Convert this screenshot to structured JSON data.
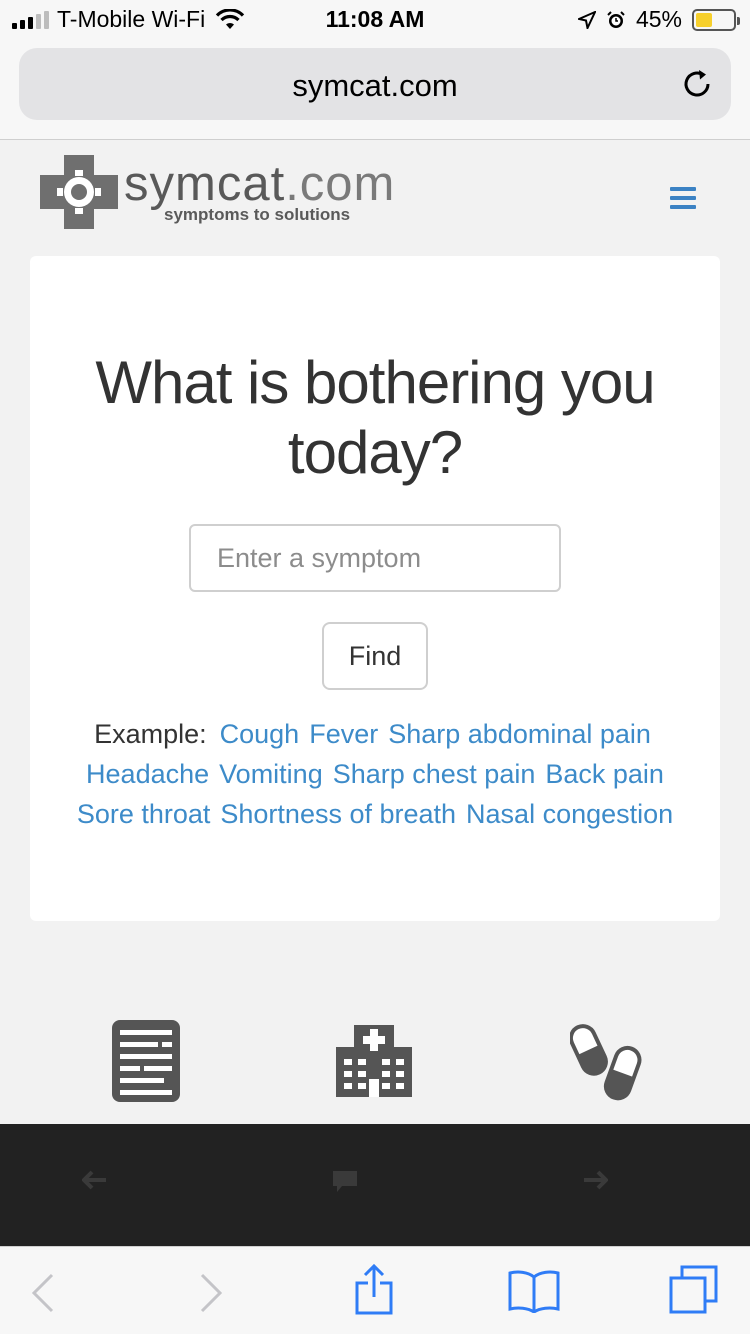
{
  "status_bar": {
    "carrier": "T-Mobile Wi-Fi",
    "time": "11:08 AM",
    "battery": "45%",
    "battery_level": 0.45,
    "icons": [
      "signal-icon",
      "wifi-icon",
      "location-icon",
      "alarm-icon",
      "battery-icon"
    ]
  },
  "address_bar": {
    "url": "symcat.com",
    "reload_icon": "reload-icon"
  },
  "site": {
    "logo_name": "symcat",
    "logo_domain": ".com",
    "logo_tagline": "symptoms to solutions",
    "menu_icon": "hamburger-menu-icon",
    "accent_color": "#3d8bc9"
  },
  "search": {
    "headline_line1": "What is bothering you",
    "headline_line2": "today?",
    "placeholder": "Enter a symptom",
    "value": "",
    "button": "Find"
  },
  "examples": {
    "label": "Example:",
    "items": [
      "Cough",
      "Fever",
      "Sharp abdominal pain",
      "Headache",
      "Vomiting",
      "Sharp chest pain",
      "Back pain",
      "Sore throat",
      "Shortness of breath",
      "Nasal congestion"
    ]
  },
  "features": {
    "icons": [
      "document-icon",
      "hospital-icon",
      "pills-icon"
    ]
  },
  "dark_bar": {
    "icons": [
      "arrow-left-icon",
      "chat-icon",
      "arrow-right-icon"
    ]
  },
  "toolbar": {
    "icons": [
      "back-icon",
      "forward-icon",
      "share-icon",
      "bookmarks-icon",
      "tabs-icon"
    ]
  }
}
